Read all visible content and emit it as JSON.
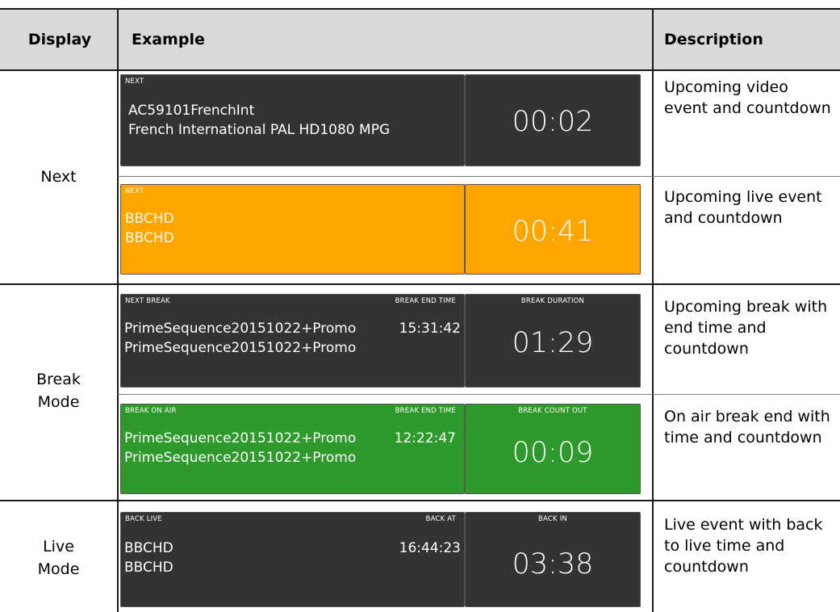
{
  "headers": {
    "display": "Display",
    "example": "Example",
    "description": "Description"
  },
  "groups": [
    {
      "label": "Next"
    },
    {
      "label": "Break Mode"
    },
    {
      "label": "Live Mode"
    }
  ],
  "rows": [
    {
      "color": "#333333",
      "left_label": "NEXT",
      "mid_label": "",
      "right_label": "",
      "line1": "AC59101FrenchInt",
      "line2": "French International PAL HD1080 MPG",
      "time": "",
      "countdown": "00:02",
      "description": "Upcoming video event and countdown"
    },
    {
      "color": "#ffa500",
      "left_label": "NEXT",
      "mid_label": "",
      "right_label": "",
      "line1": "BBCHD",
      "line2": "BBCHD",
      "time": "",
      "countdown": "00:41",
      "description": "Upcoming live event and countdown"
    },
    {
      "color": "#333333",
      "left_label": "NEXT BREAK",
      "mid_label": "BREAK END TIME",
      "right_label": "BREAK DURATION",
      "line1": "PrimeSequence20151022+Promo",
      "line2": "PrimeSequence20151022+Promo",
      "time": "15:31:42",
      "countdown": "01:29",
      "description": "Upcoming break with end time and countdown"
    },
    {
      "color": "#2e9a2b",
      "left_label": "BREAK ON AIR",
      "mid_label": "BREAK END TIME",
      "right_label": "BREAK COUNT OUT",
      "line1": "PrimeSequence20151022+Promo",
      "line2": "PrimeSequence20151022+Promo",
      "time": "12:22:47",
      "countdown": "00:09",
      "description": "On air break end with time and countdown"
    },
    {
      "color": "#333333",
      "left_label": "BACK LIVE",
      "mid_label": "BACK AT",
      "right_label": "BACK IN",
      "line1": "BBCHD",
      "line2": "BBCHD",
      "time": "16:44:23",
      "countdown": "03:38",
      "description": "Live event with back to live time and countdown"
    }
  ]
}
